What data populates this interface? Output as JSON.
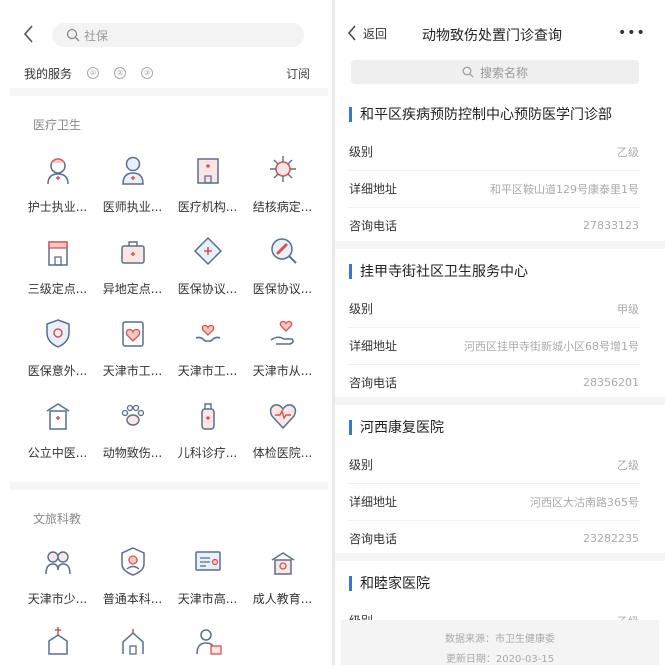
{
  "left": {
    "search_placeholder": "社保",
    "my_services": "我的服务",
    "service_icons": [
      "①",
      "②",
      "③"
    ],
    "subscribe": "订阅",
    "sections": [
      {
        "title": "医疗卫生",
        "items": [
          {
            "label": "护士执业...",
            "icon": "nurse-icon"
          },
          {
            "label": "医师执业...",
            "icon": "doctor-icon"
          },
          {
            "label": "医疗机构...",
            "icon": "hospital-building-icon"
          },
          {
            "label": "结核病定...",
            "icon": "virus-icon"
          },
          {
            "label": "三级定点...",
            "icon": "clinic-icon"
          },
          {
            "label": "异地定点...",
            "icon": "medical-bag-icon"
          },
          {
            "label": "医保协议...",
            "icon": "diamond-plus-icon"
          },
          {
            "label": "医保协议...",
            "icon": "pill-search-icon"
          },
          {
            "label": "医保意外...",
            "icon": "shield-eye-icon"
          },
          {
            "label": "天津市工...",
            "icon": "heart-card-icon"
          },
          {
            "label": "天津市工...",
            "icon": "hands-heart-icon"
          },
          {
            "label": "天津市从...",
            "icon": "hand-heart-icon"
          },
          {
            "label": "公立中医...",
            "icon": "tcm-hospital-icon"
          },
          {
            "label": "动物致伤...",
            "icon": "paw-icon"
          },
          {
            "label": "儿科诊疗...",
            "icon": "baby-bottle-icon"
          },
          {
            "label": "体检医院...",
            "icon": "heart-pulse-icon"
          }
        ]
      },
      {
        "title": "文旅科教",
        "items": [
          {
            "label": "天津市少...",
            "icon": "children-icon"
          },
          {
            "label": "普通本科...",
            "icon": "graduate-icon"
          },
          {
            "label": "天津市高...",
            "icon": "certificate-icon"
          },
          {
            "label": "成人教育...",
            "icon": "adult-education-icon"
          },
          {
            "label": "",
            "icon": "church-icon"
          },
          {
            "label": "",
            "icon": "temple-icon"
          },
          {
            "label": "",
            "icon": "person-card-icon"
          }
        ]
      }
    ]
  },
  "right": {
    "back_label": "返回",
    "title": "动物致伤处置门诊查询",
    "more": "•••",
    "search_placeholder": "搜索名称",
    "field_labels": {
      "level": "级别",
      "address": "详细地址",
      "phone": "咨询电话"
    },
    "entries": [
      {
        "name": "和平区疾病预防控制中心预防医学门诊部",
        "level": "乙级",
        "address": "和平区鞍山道129号康泰里1号",
        "phone": "27833123"
      },
      {
        "name": "挂甲寺街社区卫生服务中心",
        "level": "甲级",
        "address": "河西区挂甲寺街新城小区68号增1号",
        "phone": "28356201"
      },
      {
        "name": "河西康复医院",
        "level": "乙级",
        "address": "河西区大沽南路365号",
        "phone": "23282235"
      },
      {
        "name": "和睦家医院",
        "level": "乙级",
        "address": "",
        "phone": ""
      }
    ],
    "footer": {
      "source": "数据来源：市卫生健康委",
      "updated": "更新日期：2020-03-15"
    }
  },
  "colors": {
    "accent": "#3776d6",
    "icon_red": "#d9534f",
    "icon_blue": "#5a6e91"
  }
}
